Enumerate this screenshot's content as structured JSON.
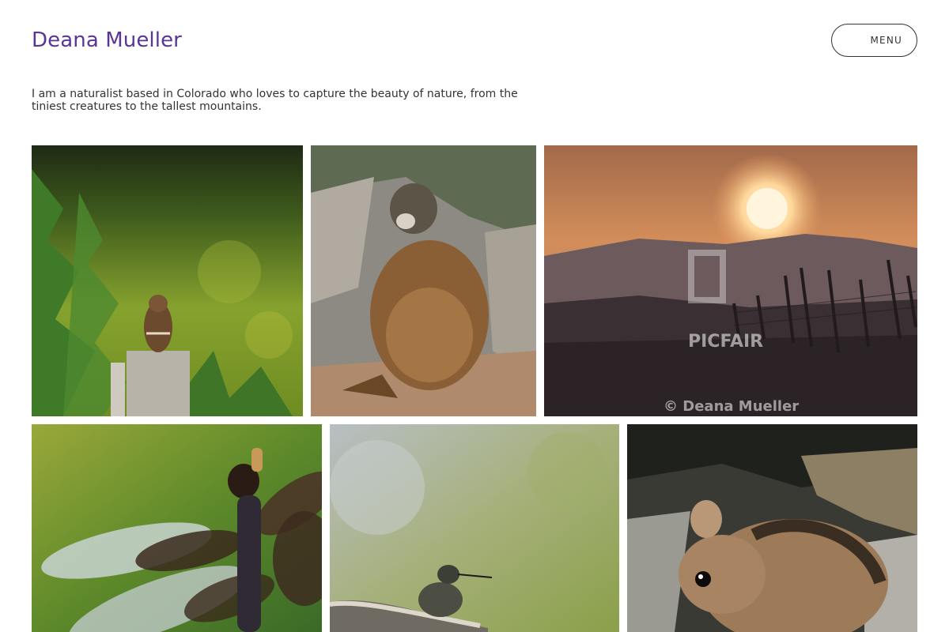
{
  "header": {
    "site_title": "Deana Mueller",
    "menu_label": "MENU"
  },
  "intro": {
    "bio": "I am a naturalist based in Colorado who loves to capture the beauty of nature, from the tiniest creatures to the tallest mountains."
  },
  "gallery": {
    "watermark_brand": "PICFAIR",
    "watermark_copyright": "© Deana Mueller",
    "photos": [
      {
        "subject": "Chipmunk on a fence post"
      },
      {
        "subject": "Yellow-bellied marmot"
      },
      {
        "subject": "Mountain sunset over fence"
      },
      {
        "subject": "Dragonfly"
      },
      {
        "subject": "Hummingbird on a branch"
      },
      {
        "subject": "Ground squirrel on lichen rock"
      }
    ]
  },
  "colors": {
    "title": "#5a3596",
    "text": "#333333",
    "background": "#ffffff"
  }
}
